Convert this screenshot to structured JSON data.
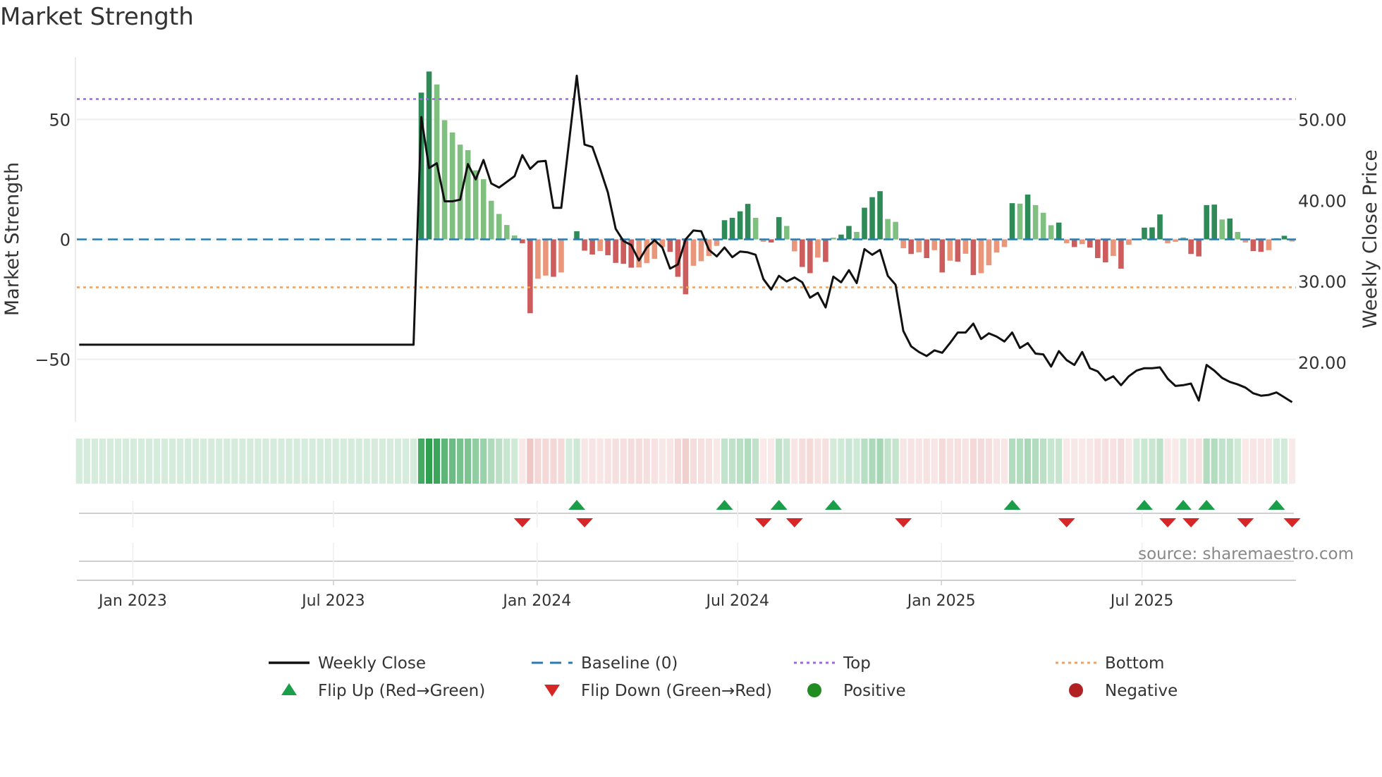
{
  "title": "Market Strength",
  "source": "source: sharemaestro.com",
  "chart_data": {
    "type": "bar+line",
    "title": "Market Strength",
    "ylabel_left": "Market Strength",
    "ylabel_right": "Weekly Close Price",
    "ylim_left": [
      -76,
      76
    ],
    "ylim_right": [
      12.7,
      57.7
    ],
    "yticks_left": [
      {
        "v": 50,
        "label": "50"
      },
      {
        "v": 0,
        "label": "0"
      },
      {
        "v": -50,
        "label": "−50"
      }
    ],
    "yticks_right": [
      {
        "v": 50,
        "label": "50.00"
      },
      {
        "v": 40,
        "label": "40.00"
      },
      {
        "v": 30,
        "label": "30.00"
      },
      {
        "v": 20,
        "label": "20.00"
      }
    ],
    "x_unit": "week index",
    "xlim": [
      -0.3,
      156.5
    ],
    "xticks": [
      {
        "week": 6.9,
        "label": "Jan 2023"
      },
      {
        "week": 32.7,
        "label": "Jul 2023"
      },
      {
        "week": 58.9,
        "label": "Jan 2024"
      },
      {
        "week": 84.7,
        "label": "Jul 2024"
      },
      {
        "week": 110.9,
        "label": "Jan 2025"
      },
      {
        "week": 136.7,
        "label": "Jul 2025"
      }
    ],
    "top_level": 58.5,
    "bottom_level": -20,
    "baseline": 0,
    "strength": [
      0,
      0,
      0,
      0,
      0,
      0,
      0,
      0,
      0,
      0,
      0,
      0,
      0,
      0,
      0,
      0,
      0,
      0,
      0,
      0,
      0,
      0,
      0,
      0,
      0,
      0,
      0,
      0,
      0,
      0,
      0,
      0,
      0,
      0,
      0,
      0,
      0,
      0,
      0,
      0,
      0,
      0,
      0,
      0,
      61.2,
      70.0,
      64.6,
      49.7,
      44.6,
      39.5,
      37.2,
      28.8,
      25.1,
      16.1,
      10.6,
      6.0,
      1.6,
      -1.6,
      -30.8,
      -16.4,
      -15.1,
      -15.6,
      -13.8,
      0,
      3.4,
      -4.7,
      -6.3,
      -4.9,
      -6.6,
      -9.8,
      -10.2,
      -11.8,
      -11.7,
      -9.9,
      -8.1,
      -3.2,
      -5.2,
      -15.6,
      -22.9,
      -11.0,
      -9.1,
      -6.9,
      -2.7,
      8.0,
      9.0,
      11.7,
      14.8,
      9.0,
      -1.0,
      -1.3,
      9.3,
      5.6,
      -5.0,
      -11.5,
      -14.1,
      -7.6,
      -9.4,
      0.7,
      2.0,
      5.6,
      3.1,
      13.2,
      17.6,
      20.1,
      8.5,
      7.3,
      -3.7,
      -6.1,
      -5.4,
      -7.8,
      -4.5,
      -13.8,
      -8.9,
      -9.3,
      -6.0,
      -14.9,
      -14.1,
      -10.8,
      -5.5,
      -3.2,
      15.1,
      14.9,
      18.7,
      14.3,
      11.1,
      5.9,
      7.0,
      -1.6,
      -3.2,
      -2.0,
      -3.4,
      -7.8,
      -9.6,
      -6.9,
      -12.2,
      -2.2,
      0,
      4.9,
      5.0,
      10.4,
      -1.6,
      -1.0,
      0.8,
      -6.1,
      -7.1,
      14.3,
      14.5,
      8.3,
      8.7,
      3.1,
      -1.3,
      -4.9,
      -5.2,
      -4.5,
      0.5,
      1.5,
      -0.9
    ],
    "weekly_close": [
      22.2,
      22.2,
      22.2,
      22.2,
      22.2,
      22.2,
      22.2,
      22.2,
      22.2,
      22.2,
      22.2,
      22.2,
      22.2,
      22.2,
      22.2,
      22.2,
      22.2,
      22.2,
      22.2,
      22.2,
      22.2,
      22.2,
      22.2,
      22.2,
      22.2,
      22.2,
      22.2,
      22.2,
      22.2,
      22.2,
      22.2,
      22.2,
      22.2,
      22.2,
      22.2,
      22.2,
      22.2,
      22.2,
      22.2,
      22.2,
      22.2,
      22.2,
      22.2,
      22.2,
      50.3,
      44.0,
      44.6,
      39.9,
      39.9,
      40.1,
      44.5,
      42.6,
      45.0,
      42.1,
      41.6,
      42.3,
      43.0,
      45.6,
      43.9,
      44.8,
      44.9,
      39.1,
      39.1,
      47.2,
      55.4,
      46.9,
      46.6,
      43.9,
      41.0,
      36.5,
      35.0,
      34.5,
      32.6,
      34.2,
      35.1,
      34.2,
      31.6,
      32.1,
      35.2,
      36.3,
      36.2,
      33.9,
      33.1,
      34.2,
      33.0,
      33.7,
      33.6,
      33.3,
      30.3,
      29.0,
      30.7,
      30.0,
      30.5,
      29.9,
      28.0,
      28.6,
      26.8,
      30.6,
      29.9,
      31.4,
      29.8,
      34.0,
      33.3,
      33.9,
      30.7,
      29.6,
      23.9,
      22.0,
      21.3,
      20.8,
      21.5,
      21.2,
      22.4,
      23.7,
      23.7,
      24.8,
      22.9,
      23.6,
      23.2,
      22.6,
      23.7,
      21.8,
      22.4,
      21.1,
      21.0,
      19.5,
      21.4,
      20.3,
      19.7,
      21.3,
      19.3,
      18.9,
      17.8,
      18.3,
      17.2,
      18.3,
      19.0,
      19.3,
      19.3,
      19.4,
      18.0,
      17.1,
      17.2,
      17.4,
      15.3,
      19.7,
      19.0,
      18.1,
      17.6,
      17.3,
      16.9,
      16.2,
      15.9,
      16.0,
      16.3,
      15.7,
      15.1
    ],
    "legend": {
      "placement": "bottom",
      "items": [
        {
          "label": "Weekly Close",
          "kind": "line",
          "color": "#111111"
        },
        {
          "label": "Baseline (0)",
          "kind": "dash",
          "color": "#2a7bb0"
        },
        {
          "label": "Top",
          "kind": "dot",
          "color": "#a066dd"
        },
        {
          "label": "Bottom",
          "kind": "dot",
          "color": "#f0a060"
        },
        {
          "label": "Flip Up (Red→Green)",
          "kind": "tri-up",
          "color": "#1a9e4a"
        },
        {
          "label": "Flip Down (Green→Red)",
          "kind": "tri-down",
          "color": "#d62728"
        },
        {
          "label": "Positive",
          "kind": "circle",
          "color": "#228b22"
        },
        {
          "label": "Negative",
          "kind": "circle",
          "color": "#b22222"
        }
      ]
    },
    "colors": {
      "pos_dark": "#2e8b57",
      "pos_light": "#7fbf7f",
      "neg_dark": "#cd5c5c",
      "neg_light": "#e9967a",
      "strip_pos": "#2ea04f",
      "strip_neg": "#cc4444"
    }
  }
}
